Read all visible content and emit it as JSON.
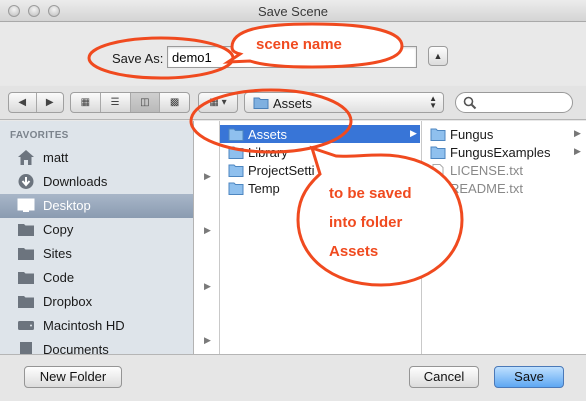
{
  "window": {
    "title": "Save Scene"
  },
  "save_as": {
    "label": "Save As:",
    "value": "demo1"
  },
  "toolbar": {
    "path_folder": "Assets"
  },
  "sidebar": {
    "heading": "FAVORITES",
    "items": [
      {
        "label": "matt",
        "icon": "home-icon"
      },
      {
        "label": "Downloads",
        "icon": "downloads-icon"
      },
      {
        "label": "Desktop",
        "icon": "desktop-icon",
        "selected": true
      },
      {
        "label": "Copy",
        "icon": "folder-icon"
      },
      {
        "label": "Sites",
        "icon": "folder-icon"
      },
      {
        "label": "Code",
        "icon": "folder-icon"
      },
      {
        "label": "Dropbox",
        "icon": "folder-icon"
      },
      {
        "label": "Macintosh HD",
        "icon": "hard-drive-icon"
      },
      {
        "label": "Documents",
        "icon": "documents-icon"
      }
    ]
  },
  "columns": {
    "col2": [
      {
        "name": "Assets",
        "type": "folder",
        "selected": true
      },
      {
        "name": "Library",
        "type": "folder"
      },
      {
        "name": "ProjectSetti",
        "type": "folder"
      },
      {
        "name": "Temp",
        "type": "folder"
      }
    ],
    "col3": [
      {
        "name": "Fungus",
        "type": "folder"
      },
      {
        "name": "FungusExamples",
        "type": "folder"
      },
      {
        "name": "LICENSE.txt",
        "type": "file"
      },
      {
        "name": "README.txt",
        "type": "file"
      }
    ]
  },
  "buttons": {
    "new_folder": "New Folder",
    "cancel": "Cancel",
    "save": "Save"
  },
  "annotations": {
    "scene_name": "scene name",
    "folder_line1": "to be saved",
    "folder_line2": "into folder",
    "folder_line3": "Assets"
  },
  "colors": {
    "annotation": "#f04a1f",
    "selection": "#3875d7",
    "sidebar_bg": "#dee4ea"
  }
}
